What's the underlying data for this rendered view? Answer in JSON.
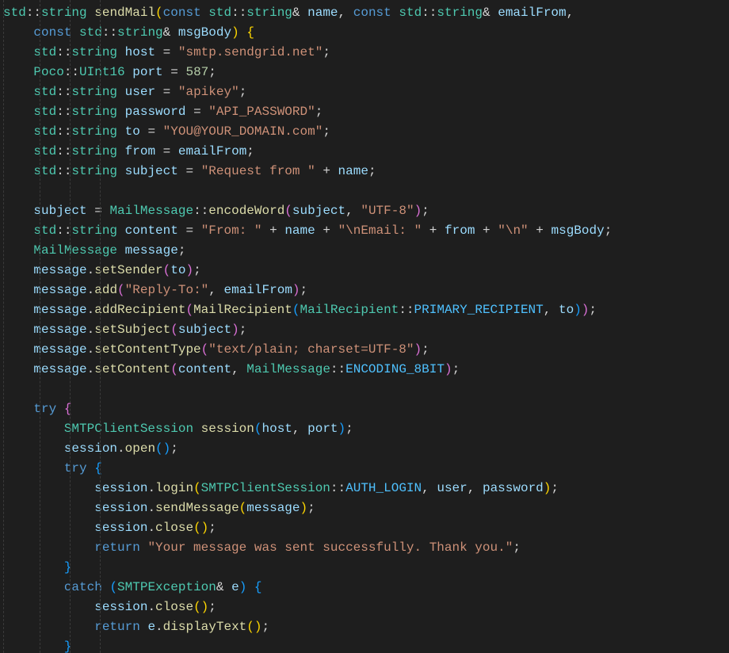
{
  "code": {
    "fn_name": "sendMail",
    "param_name": "name",
    "param_emailFrom": "emailFrom",
    "param_msgBody": "msgBody",
    "host_var": "host",
    "host_val": "\"smtp.sendgrid.net\"",
    "port_var": "port",
    "port_val": "587",
    "user_var": "user",
    "user_val": "\"apikey\"",
    "password_var": "password",
    "password_val": "\"API_PASSWORD\"",
    "to_var": "to",
    "to_val": "\"YOU@YOUR_DOMAIN.com\"",
    "from_var": "from",
    "subject_var": "subject",
    "subject_prefix": "\"Request from \"",
    "utf8": "\"UTF-8\"",
    "content_var": "content",
    "content_from": "\"From: \"",
    "content_email": "\"\\nEmail: \"",
    "content_nl": "\"\\n\"",
    "message_var": "message",
    "reply_to": "\"Reply-To:\"",
    "ct_val": "\"text/plain; charset=UTF-8\"",
    "session_var": "session",
    "e_var": "e",
    "success": "\"Your message was sent successfully. Thank you.\"",
    "kw_const": "const",
    "kw_try": "try",
    "kw_catch": "catch",
    "kw_return": "return",
    "ns_std": "std",
    "ns_poco": "Poco",
    "t_string": "string",
    "t_uint16": "UInt16",
    "t_MailMessage": "MailMessage",
    "t_MailRecipient": "MailRecipient",
    "t_SMTPClientSession": "SMTPClientSession",
    "t_SMTPException": "SMTPException",
    "m_encodeWord": "encodeWord",
    "m_setSender": "setSender",
    "m_add": "add",
    "m_addRecipient": "addRecipient",
    "m_setSubject": "setSubject",
    "m_setContentType": "setContentType",
    "m_setContent": "setContent",
    "m_open": "open",
    "m_login": "login",
    "m_sendMessage": "sendMessage",
    "m_close": "close",
    "m_displayText": "displayText",
    "c_PRIMARY_RECIPIENT": "PRIMARY_RECIPIENT",
    "c_ENCODING_8BIT": "ENCODING_8BIT",
    "c_AUTH_LOGIN": "AUTH_LOGIN"
  }
}
